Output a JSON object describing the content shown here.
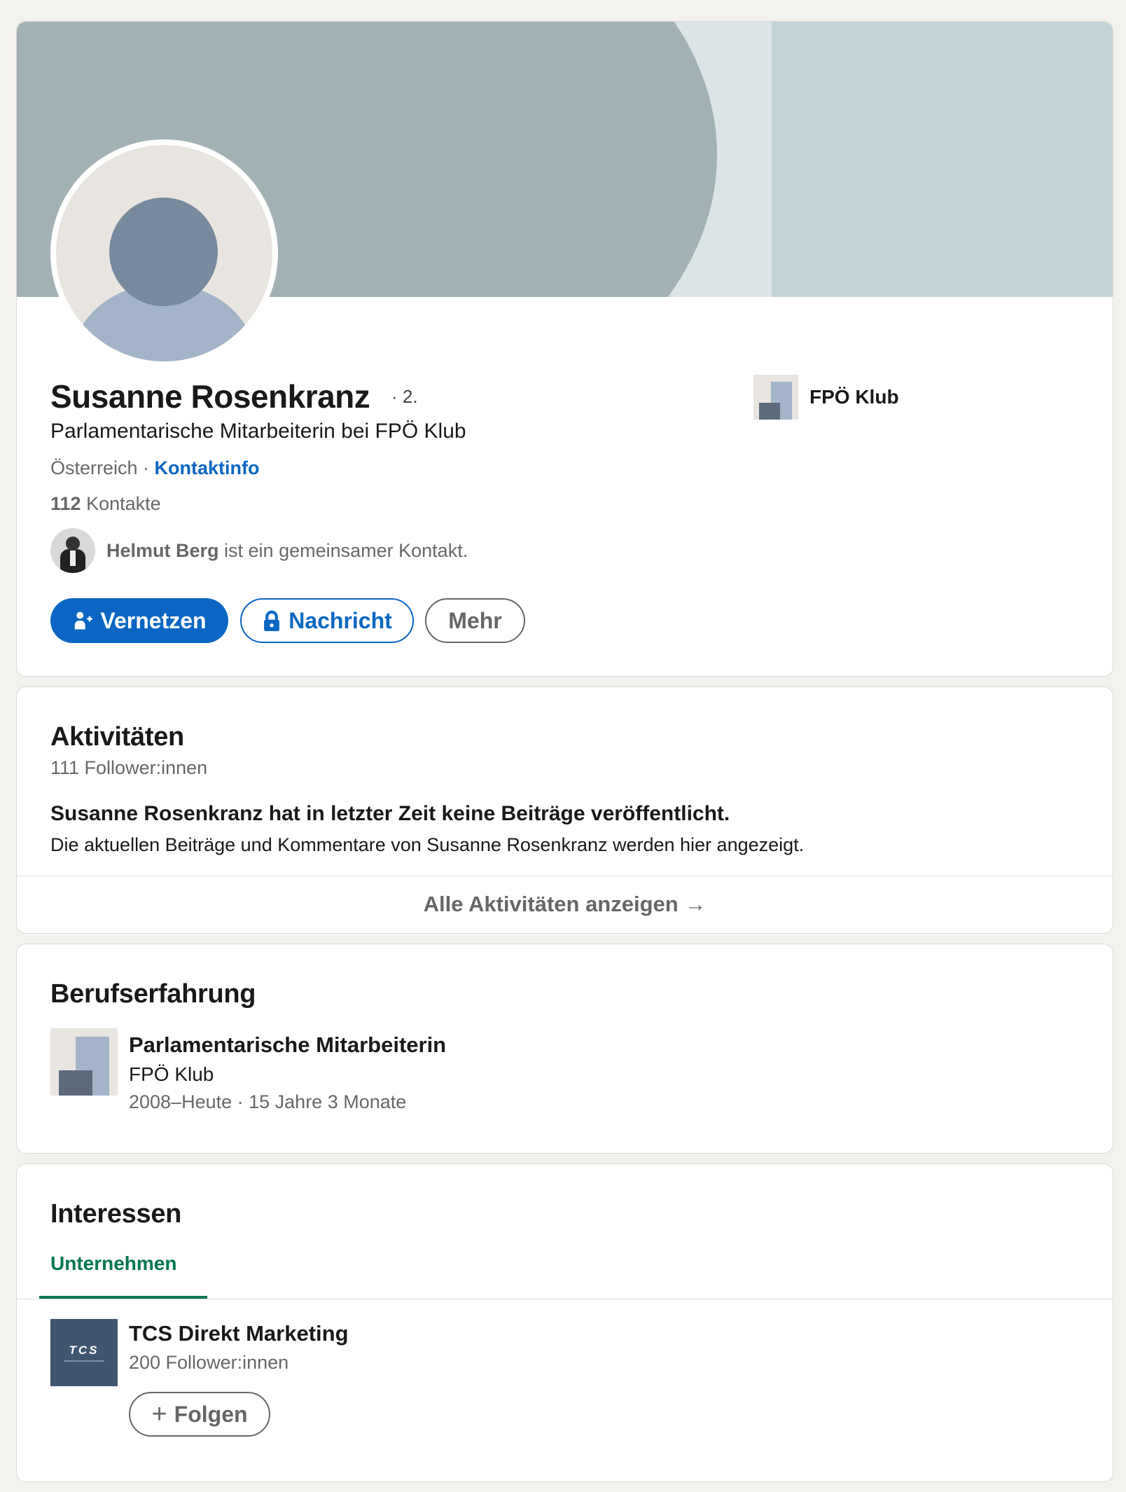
{
  "profile": {
    "name": "Susanne Rosenkranz",
    "degree": "· 2.",
    "headline": "Parlamentarische Mitarbeiterin bei FPÖ Klub",
    "location": "Österreich",
    "location_sep": " · ",
    "contact_info": "Kontaktinfo",
    "connections_count": "112",
    "connections_label": " Kontakte",
    "mutual_name": "Helmut Berg",
    "mutual_text": " ist ein gemeinsamer Kontakt.",
    "current_company": "FPÖ Klub"
  },
  "actions": {
    "connect": "Vernetzen",
    "message": "Nachricht",
    "more": "Mehr"
  },
  "activity": {
    "title": "Aktivitäten",
    "followers": "111 Follower:innen",
    "empty_title": "Susanne Rosenkranz hat in letzter Zeit keine Beiträge veröffentlicht.",
    "empty_desc": "Die aktuellen Beiträge und Kommentare von Susanne Rosenkranz werden hier angezeigt.",
    "show_all": "Alle Aktivitäten anzeigen →"
  },
  "experience": {
    "title": "Berufserfahrung",
    "items": [
      {
        "role": "Parlamentarische Mitarbeiterin",
        "company": "FPÖ Klub",
        "dates": "2008–Heute · 15 Jahre 3 Monate"
      }
    ]
  },
  "interests": {
    "title": "Interessen",
    "tab": "Unternehmen",
    "items": [
      {
        "logo_text": "TCS",
        "name": "TCS Direkt Marketing",
        "followers": "200 Follower:innen",
        "follow_label": "Folgen"
      }
    ]
  },
  "colors": {
    "primary": "#0a66c2",
    "accent_green": "#01754f",
    "page_bg": "#f4f2ee"
  }
}
